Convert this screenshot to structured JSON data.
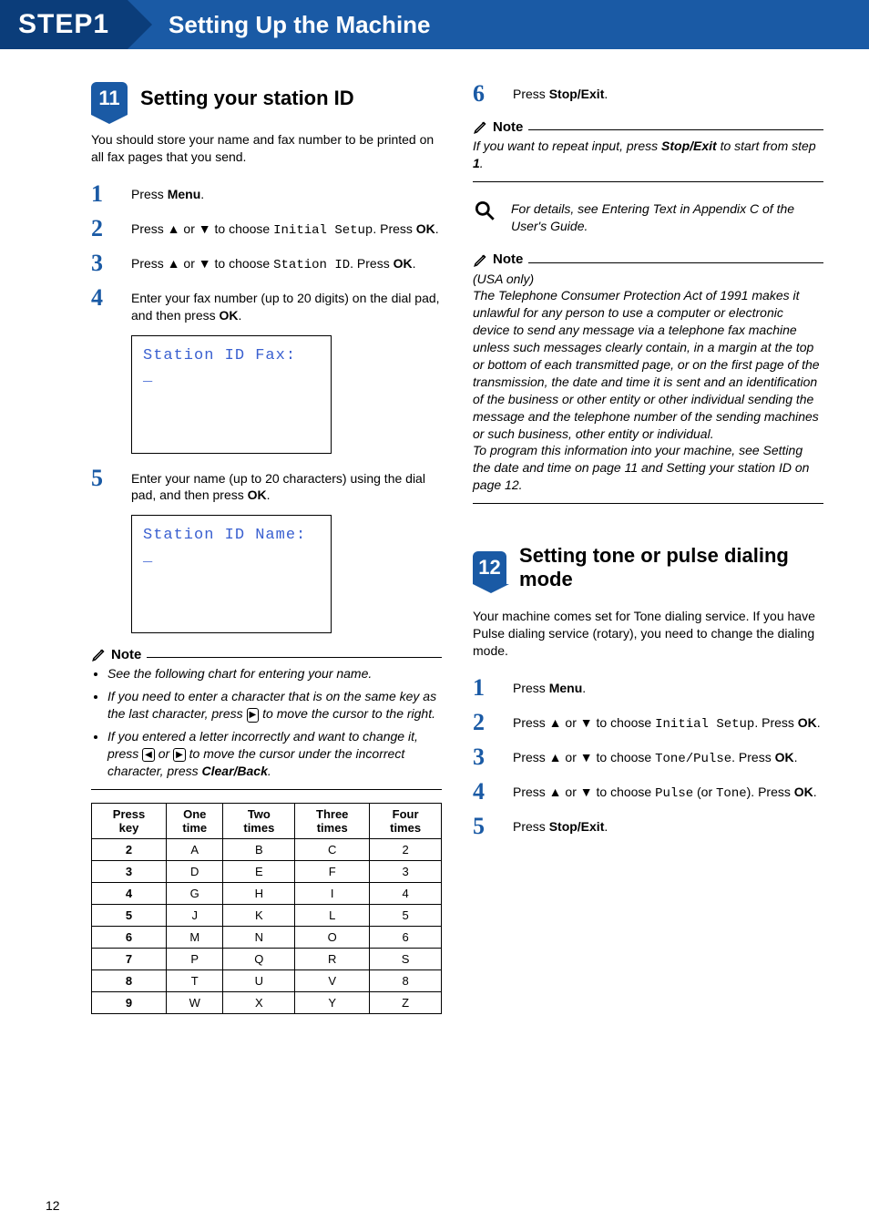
{
  "banner": {
    "step": "STEP1",
    "title": "Setting Up the Machine"
  },
  "section11": {
    "badge": "11",
    "title": "Setting your station ID",
    "intro": "You should store your name and fax number to be printed on all fax pages that you send.",
    "steps": {
      "s1": {
        "n": "1",
        "text_a": "Press ",
        "bold_a": "Menu",
        "text_b": "."
      },
      "s2": {
        "n": "2",
        "text_a": "Press ▲ or ▼ to choose ",
        "mono": "Initial Setup",
        "text_b": ". Press ",
        "bold_b": "OK",
        "text_c": "."
      },
      "s3": {
        "n": "3",
        "text_a": "Press ▲ or ▼ to choose ",
        "mono": "Station ID",
        "text_b": ". Press ",
        "bold_b": "OK",
        "text_c": "."
      },
      "s4": {
        "n": "4",
        "text_a": "Enter your fax number (up to 20 digits) on the dial pad, and then press ",
        "bold_a": "OK",
        "text_b": "."
      },
      "s5": {
        "n": "5",
        "text_a": "Enter your name (up to 20 characters) using the dial pad, and then press ",
        "bold_a": "OK",
        "text_b": "."
      }
    },
    "lcd1": "Station ID Fax:\n_",
    "lcd2": "Station ID Name:\n_",
    "note1": {
      "label": "Note",
      "b1": "See the following chart for entering your name.",
      "b2a": "If you need to enter a character that is on the same key as the last character, press ",
      "b2b": " to move the cursor to the right.",
      "b3a": "If you entered a letter incorrectly and want to change it, press ",
      "b3b": " or ",
      "b3c": " to move the cursor under the incorrect character, press ",
      "b3d": "Clear/Back",
      "b3e": "."
    },
    "keytable": {
      "headers": [
        "Press key",
        "One time",
        "Two times",
        "Three times",
        "Four times"
      ],
      "rows": [
        [
          "2",
          "A",
          "B",
          "C",
          "2"
        ],
        [
          "3",
          "D",
          "E",
          "F",
          "3"
        ],
        [
          "4",
          "G",
          "H",
          "I",
          "4"
        ],
        [
          "5",
          "J",
          "K",
          "L",
          "5"
        ],
        [
          "6",
          "M",
          "N",
          "O",
          "6"
        ],
        [
          "7",
          "P",
          "Q",
          "R",
          "S"
        ],
        [
          "8",
          "T",
          "U",
          "V",
          "8"
        ],
        [
          "9",
          "W",
          "X",
          "Y",
          "Z"
        ]
      ]
    }
  },
  "rightcol": {
    "step6": {
      "n": "6",
      "text_a": "Press ",
      "bold_a": "Stop/Exit",
      "text_b": "."
    },
    "note2": {
      "label": "Note",
      "text_a": "If you want to repeat input, press ",
      "bold_a": "Stop/Exit",
      "text_b": " to start from step ",
      "bold_b": "1",
      "text_c": "."
    },
    "refbox": "For details, see Entering Text in Appendix C of the User's Guide.",
    "note3": {
      "label": "Note",
      "p1": "(USA only)",
      "p2": "The Telephone Consumer Protection Act of 1991 makes it unlawful for any person to use a computer or electronic device to send any message via a telephone fax machine unless such messages clearly contain, in a margin at the top or bottom of each transmitted page, or on the first page of the transmission, the date and time it is sent and an identification of the business or other entity or other individual sending the message and the telephone number of the sending machines or such business, other entity or individual.",
      "p3": "To program this information into your machine, see Setting the date and time on page 11 and Setting your station ID on page 12."
    }
  },
  "section12": {
    "badge": "12",
    "title": "Setting tone or pulse dialing mode",
    "intro": "Your machine comes set for Tone dialing service. If you have Pulse dialing service (rotary), you need to change the dialing mode.",
    "steps": {
      "s1": {
        "n": "1",
        "text_a": "Press ",
        "bold_a": "Menu",
        "text_b": "."
      },
      "s2": {
        "n": "2",
        "text_a": "Press ▲ or ▼ to choose ",
        "mono": "Initial Setup",
        "text_b": ". Press ",
        "bold_b": "OK",
        "text_c": "."
      },
      "s3": {
        "n": "3",
        "text_a": "Press ▲ or ▼ to choose ",
        "mono": "Tone/Pulse",
        "text_b": ". Press ",
        "bold_b": "OK",
        "text_c": "."
      },
      "s4": {
        "n": "4",
        "text_a": "Press ▲ or ▼ to choose ",
        "mono": "Pulse",
        "paren_a": " (or ",
        "mono_b": "Tone",
        "paren_b": "). Press ",
        "bold_b": "OK",
        "text_c": "."
      },
      "s5": {
        "n": "5",
        "text_a": "Press ",
        "bold_a": "Stop/Exit",
        "text_b": "."
      }
    }
  },
  "page_number": "12"
}
